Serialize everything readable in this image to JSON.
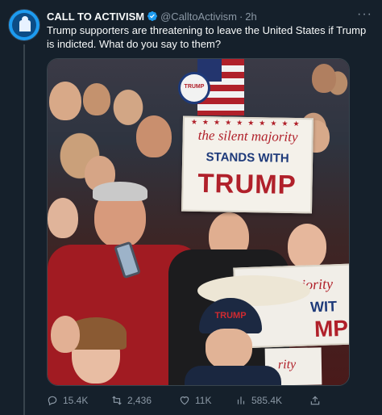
{
  "tweet": {
    "author_name": "CALL TO ACTIVISM",
    "handle": "@CalltoActivism",
    "separator": "·",
    "time": "2h",
    "text": "Trump supporters are threatening to leave the United States if Trump is indicted. What do you say to them?"
  },
  "media": {
    "sign_line1": "the silent majority",
    "sign_line2": "STANDS WITH",
    "sign_line3": "TRUMP",
    "sign2_a": "majority",
    "sign2_b": "WIT",
    "sign2_c": "MP",
    "sign3_d": "rity",
    "cap_text": "TRUMP",
    "pin_text": "TRUMP"
  },
  "actions": {
    "replies": "15.4K",
    "retweets": "2,436",
    "likes": "11K",
    "views": "585.4K"
  },
  "icons": {
    "more": "more-icon",
    "verified": "verified-badge-icon",
    "reply": "reply-icon",
    "retweet": "retweet-icon",
    "like": "heart-icon",
    "views": "views-icon",
    "share": "share-icon"
  },
  "colors": {
    "background": "#15202b",
    "text": "#f7f9f9",
    "muted": "#8b98a5",
    "accent": "#1d9bf0"
  }
}
